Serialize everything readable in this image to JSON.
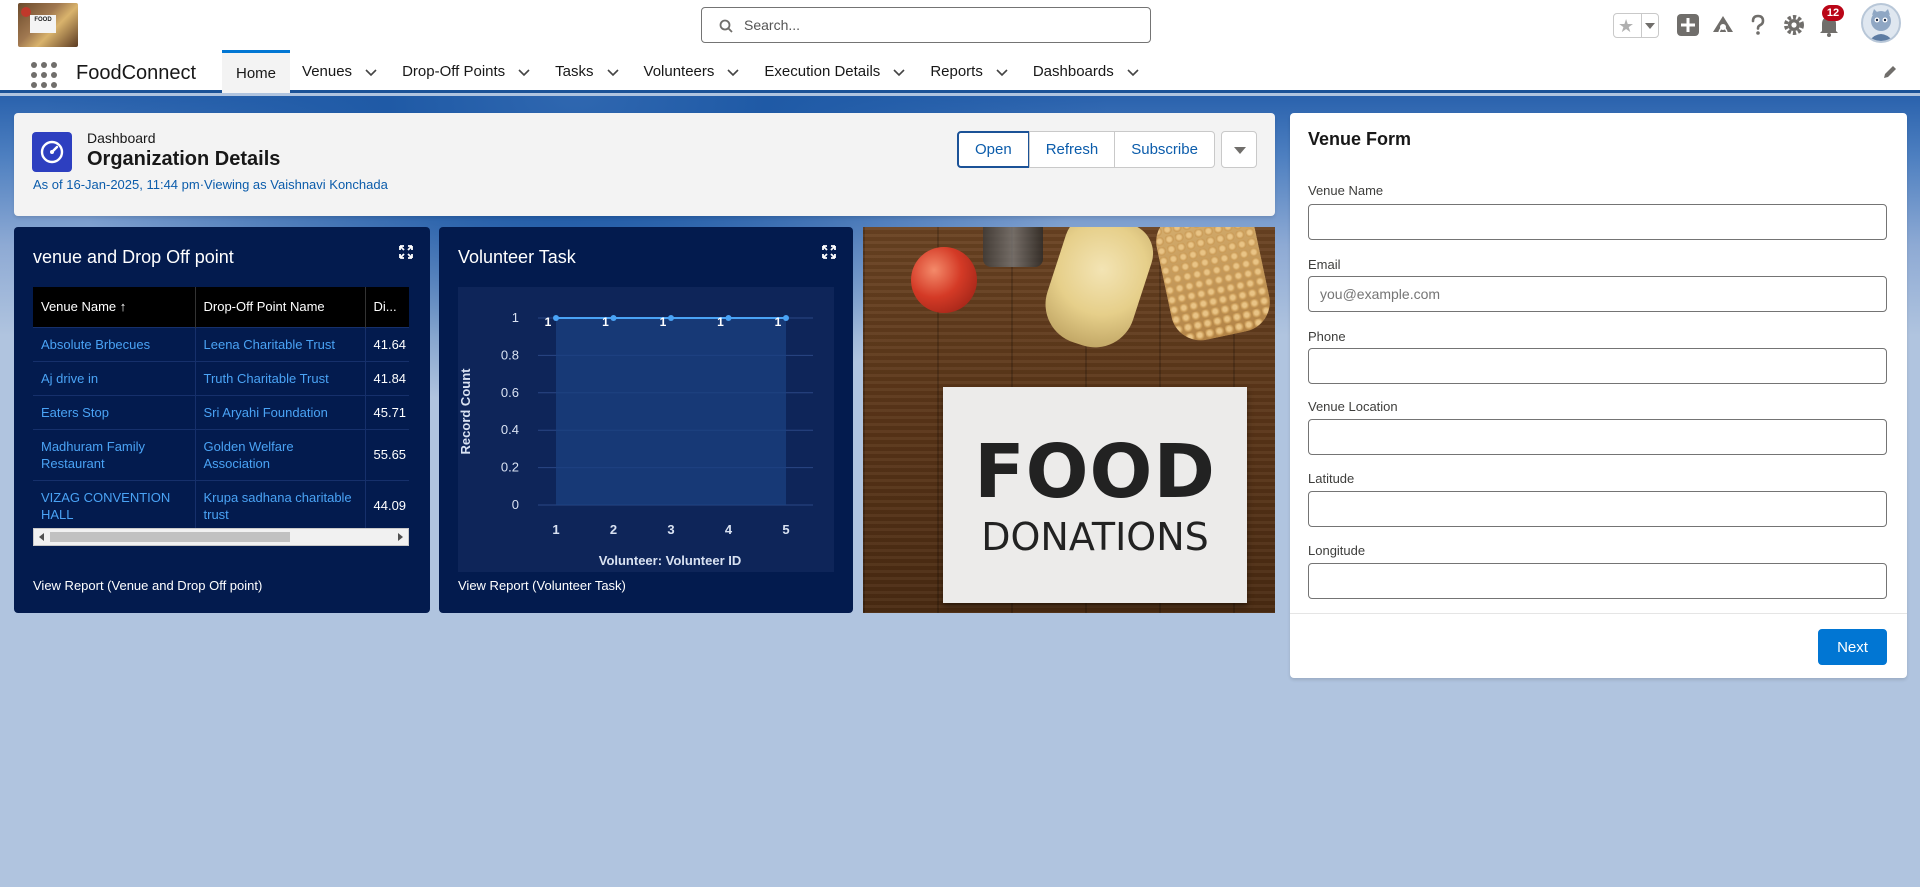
{
  "header": {
    "logo_text": "FOOD",
    "search_placeholder": "Search...",
    "notification_count": "12"
  },
  "nav": {
    "app_name": "FoodConnect",
    "tabs": [
      {
        "label": "Home",
        "active": true
      },
      {
        "label": "Venues"
      },
      {
        "label": "Drop-Off Points"
      },
      {
        "label": "Tasks"
      },
      {
        "label": "Volunteers"
      },
      {
        "label": "Execution Details"
      },
      {
        "label": "Reports"
      },
      {
        "label": "Dashboards"
      }
    ]
  },
  "dashboard": {
    "eyebrow": "Dashboard",
    "title": "Organization Details",
    "meta": "As of 16-Jan-2025, 11:44 pm·Viewing as Vaishnavi Konchada",
    "buttons": {
      "open": "Open",
      "refresh": "Refresh",
      "subscribe": "Subscribe"
    }
  },
  "venue_widget": {
    "title": "venue and Drop Off point",
    "columns": [
      "Venue Name ↑",
      "Drop-Off Point Name",
      "Di..."
    ],
    "rows": [
      [
        "Absolute Brbecues",
        "Leena Charitable Trust",
        "41.64"
      ],
      [
        "Aj drive in",
        "Truth Charitable Trust",
        "41.84"
      ],
      [
        "Eaters Stop",
        "Sri Aryahi Foundation",
        "45.71"
      ],
      [
        "Madhuram Family Restaurant",
        "Golden Welfare Association",
        "55.65"
      ],
      [
        "VIZAG CONVENTION HALL",
        "Krupa sadhana charitable trust",
        "44.09"
      ]
    ],
    "footer": "View Report (Venue and Drop Off point)"
  },
  "volunteer_widget": {
    "title": "Volunteer Task",
    "footer": "View Report (Volunteer Task)"
  },
  "chart_data": {
    "type": "area",
    "categories": [
      "1",
      "2",
      "3",
      "4",
      "5"
    ],
    "values": [
      1,
      1,
      1,
      1,
      1
    ],
    "data_labels": [
      "1",
      "1",
      "1",
      "1",
      "1"
    ],
    "xlabel": "Volunteer: Volunteer ID",
    "ylabel": "Record Count",
    "yticks": [
      "0",
      "0.2",
      "0.4",
      "0.6",
      "0.8",
      "1"
    ],
    "ylim": [
      0,
      1
    ],
    "grid": true,
    "colors": {
      "line": "#4aa3f5",
      "fill": "#1b4080"
    }
  },
  "image": {
    "headline": "FOOD",
    "subline": "DONATIONS"
  },
  "venue_form": {
    "title": "Venue Form",
    "fields": [
      {
        "label": "Venue Name",
        "value": "",
        "placeholder": ""
      },
      {
        "label": "Email",
        "value": "",
        "placeholder": "you@example.com"
      },
      {
        "label": "Phone",
        "value": "",
        "placeholder": ""
      },
      {
        "label": "Venue Location",
        "value": "",
        "placeholder": ""
      },
      {
        "label": "Latitude",
        "value": "",
        "placeholder": ""
      },
      {
        "label": "Longitude",
        "value": "",
        "placeholder": ""
      }
    ],
    "next_label": "Next"
  },
  "colors": {
    "brand": "#0176d3",
    "nav_underline": "#1b5297",
    "widget_bg": "#031b4e",
    "link": "#4aa3f5",
    "badge": "#ba0517"
  }
}
